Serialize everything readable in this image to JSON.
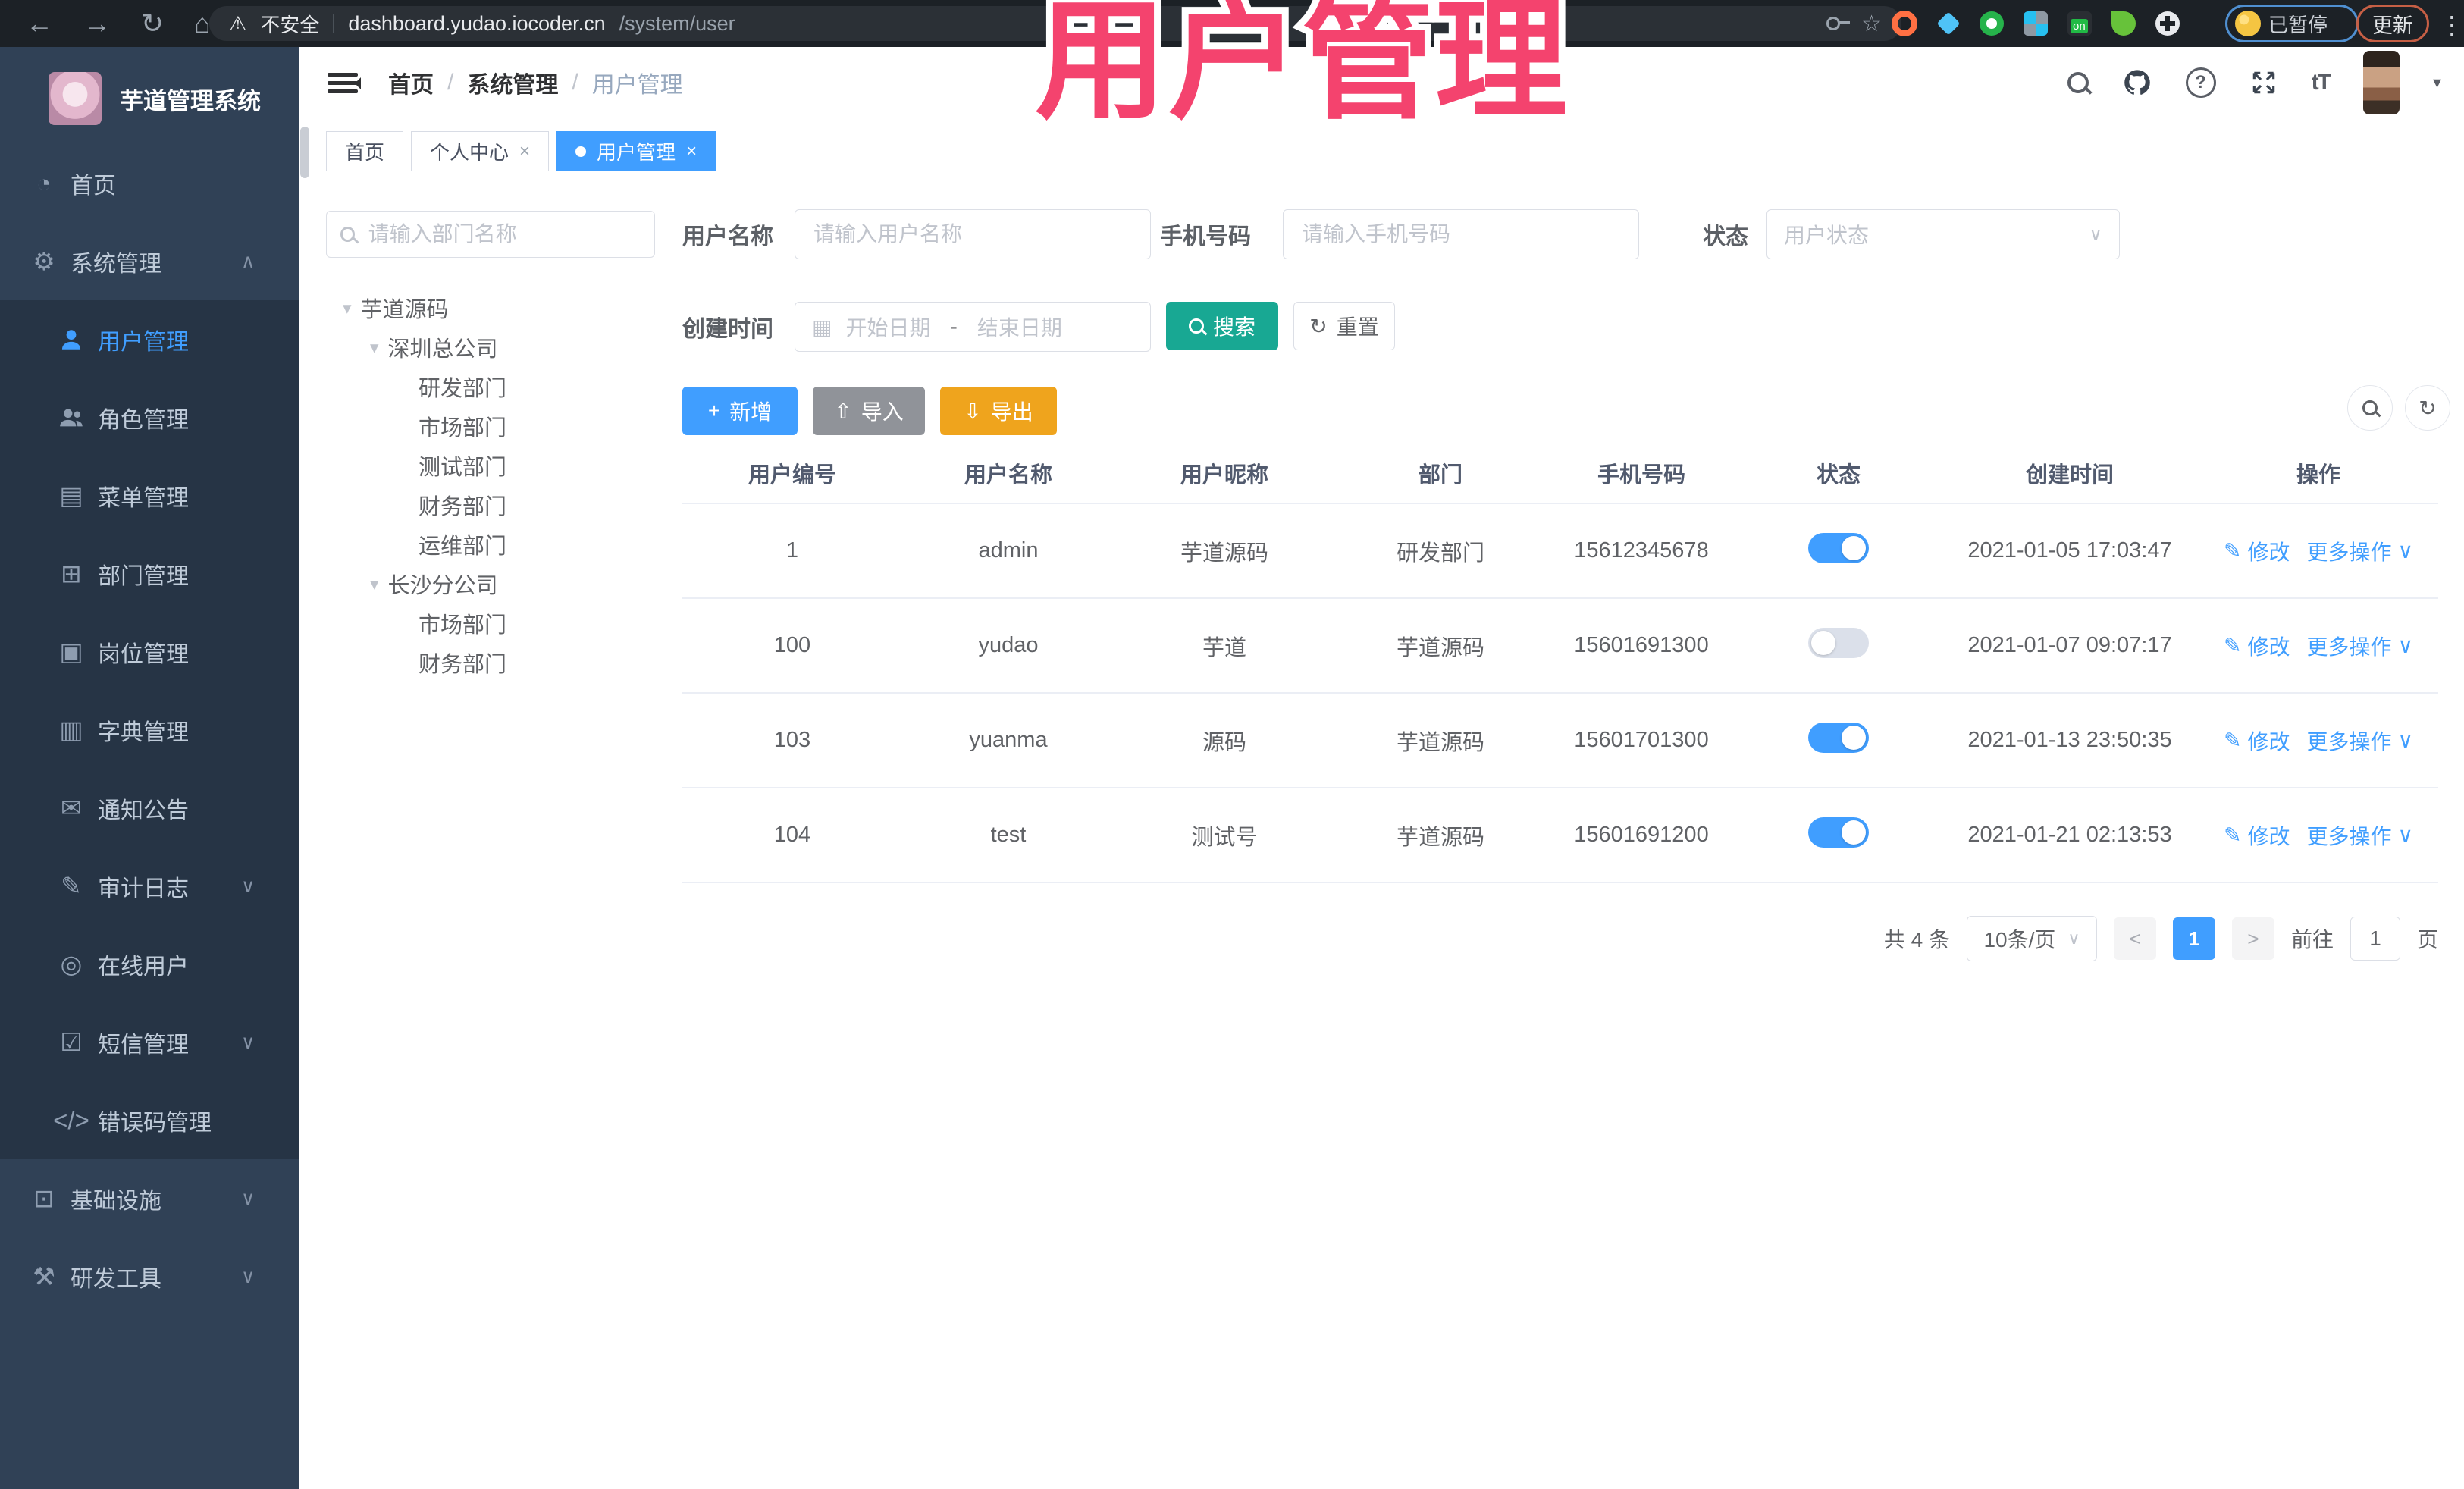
{
  "colors": {
    "accent": "#409eff",
    "sidebar_bg": "#304156",
    "submenu_bg": "#263445",
    "sidebar_text": "#bfcbd9",
    "search_button": "#18a893",
    "import_button": "#909399",
    "export_button": "#efa41d",
    "overlay_pink": "#f4436e",
    "breadcrumb_muted": "#97a8be",
    "toggle_off": "#dbe0ea"
  },
  "icons": {
    "back": "←",
    "forward": "→",
    "reload": "↻",
    "home": "⌂",
    "warning": "⚠",
    "star": "☆",
    "kebab": "⋮",
    "caret_down": "▾",
    "chevron_down": "∨",
    "chevron_up": "∧",
    "plus": "+",
    "upload": "⇧",
    "download": "⇩",
    "refresh": "↻",
    "edit": "✎",
    "calendar": "▦",
    "close": "×",
    "font_size": "tT",
    "prev": "<",
    "next": ">",
    "caret_small": "▾"
  },
  "browser": {
    "security_label": "不安全",
    "url_host": "dashboard.yudao.iocoder.cn",
    "url_path": "/system/user",
    "paused_label": "已暂停",
    "update_label": "更新"
  },
  "overlay": {
    "title": "用户管理"
  },
  "sidebar": {
    "logo_title": "芋道管理系统",
    "items": [
      {
        "key": "home",
        "label": "首页",
        "icon": "dashboard-icon",
        "glyph": "◔",
        "type": "root"
      },
      {
        "key": "system",
        "label": "系统管理",
        "icon": "gear-icon",
        "glyph": "⚙",
        "type": "root",
        "arrow": "up"
      },
      {
        "key": "user",
        "label": "用户管理",
        "icon": "user-icon",
        "glyph": "svg:person",
        "type": "sub",
        "active": true
      },
      {
        "key": "role",
        "label": "角色管理",
        "icon": "roles-icon",
        "glyph": "svg:people",
        "type": "sub"
      },
      {
        "key": "menu",
        "label": "菜单管理",
        "icon": "menu-list-icon",
        "glyph": "▤",
        "type": "sub"
      },
      {
        "key": "dept",
        "label": "部门管理",
        "icon": "org-tree-icon",
        "glyph": "⊞",
        "type": "sub"
      },
      {
        "key": "post",
        "label": "岗位管理",
        "icon": "badge-icon",
        "glyph": "▣",
        "type": "sub"
      },
      {
        "key": "dict",
        "label": "字典管理",
        "icon": "dictionary-icon",
        "glyph": "▥",
        "type": "sub"
      },
      {
        "key": "notice",
        "label": "通知公告",
        "icon": "announcement-icon",
        "glyph": "✉",
        "type": "sub"
      },
      {
        "key": "audit",
        "label": "审计日志",
        "icon": "audit-log-icon",
        "glyph": "✎",
        "type": "sub",
        "arrow": "down"
      },
      {
        "key": "online",
        "label": "在线用户",
        "icon": "online-users-icon",
        "glyph": "◎",
        "type": "sub"
      },
      {
        "key": "sms",
        "label": "短信管理",
        "icon": "sms-shield-icon",
        "glyph": "☑",
        "type": "sub",
        "arrow": "down"
      },
      {
        "key": "errcode",
        "label": "错误码管理",
        "icon": "code-icon",
        "glyph": "</>",
        "type": "sub"
      },
      {
        "key": "infra",
        "label": "基础设施",
        "icon": "infrastructure-icon",
        "glyph": "⊡",
        "type": "root",
        "arrow": "down"
      },
      {
        "key": "devtools",
        "label": "研发工具",
        "icon": "tools-icon",
        "glyph": "⚒",
        "type": "root",
        "arrow": "down"
      }
    ]
  },
  "header": {
    "breadcrumb": [
      "首页",
      "系统管理",
      "用户管理"
    ],
    "separator": "/"
  },
  "tabs": [
    {
      "label": "首页",
      "closable": false,
      "active": false
    },
    {
      "label": "个人中心",
      "closable": true,
      "active": false
    },
    {
      "label": "用户管理",
      "closable": true,
      "active": true
    }
  ],
  "tree": {
    "search_placeholder": "请输入部门名称",
    "nodes": [
      {
        "label": "芋道源码",
        "level": 0,
        "caret": true
      },
      {
        "label": "深圳总公司",
        "level": 1,
        "caret": true
      },
      {
        "label": "研发部门",
        "level": 2,
        "caret": false
      },
      {
        "label": "市场部门",
        "level": 2,
        "caret": false
      },
      {
        "label": "测试部门",
        "level": 2,
        "caret": false
      },
      {
        "label": "财务部门",
        "level": 2,
        "caret": false
      },
      {
        "label": "运维部门",
        "level": 2,
        "caret": false
      },
      {
        "label": "长沙分公司",
        "level": 1,
        "caret": true
      },
      {
        "label": "市场部门",
        "level": 2,
        "caret": false
      },
      {
        "label": "财务部门",
        "level": 2,
        "caret": false
      }
    ]
  },
  "filter": {
    "username_label": "用户名称",
    "username_placeholder": "请输入用户名称",
    "mobile_label": "手机号码",
    "mobile_placeholder": "请输入手机号码",
    "status_label": "状态",
    "status_placeholder": "用户状态",
    "created_label": "创建时间",
    "date_start": "开始日期",
    "date_separator": "-",
    "date_end": "结束日期",
    "search_label": "搜索",
    "reset_label": "重置"
  },
  "toolbar": {
    "add_label": "新增",
    "import_label": "导入",
    "export_label": "导出"
  },
  "table": {
    "headers": [
      "用户编号",
      "用户名称",
      "用户昵称",
      "部门",
      "手机号码",
      "状态",
      "创建时间",
      "操作"
    ],
    "action_edit": "修改",
    "action_more": "更多操作",
    "rows": [
      {
        "id": "1",
        "username": "admin",
        "nickname": "芋道源码",
        "dept": "研发部门",
        "mobile": "15612345678",
        "status": true,
        "created": "2021-01-05 17:03:47"
      },
      {
        "id": "100",
        "username": "yudao",
        "nickname": "芋道",
        "dept": "芋道源码",
        "mobile": "15601691300",
        "status": false,
        "created": "2021-01-07 09:07:17"
      },
      {
        "id": "103",
        "username": "yuanma",
        "nickname": "源码",
        "dept": "芋道源码",
        "mobile": "15601701300",
        "status": true,
        "created": "2021-01-13 23:50:35"
      },
      {
        "id": "104",
        "username": "test",
        "nickname": "测试号",
        "dept": "芋道源码",
        "mobile": "15601691200",
        "status": true,
        "created": "2021-01-21 02:13:53"
      }
    ]
  },
  "pagination": {
    "total_text": "共 4 条",
    "page_size": "10条/页",
    "current_page": "1",
    "goto_label": "前往",
    "goto_value": "1",
    "unit_label": "页"
  }
}
